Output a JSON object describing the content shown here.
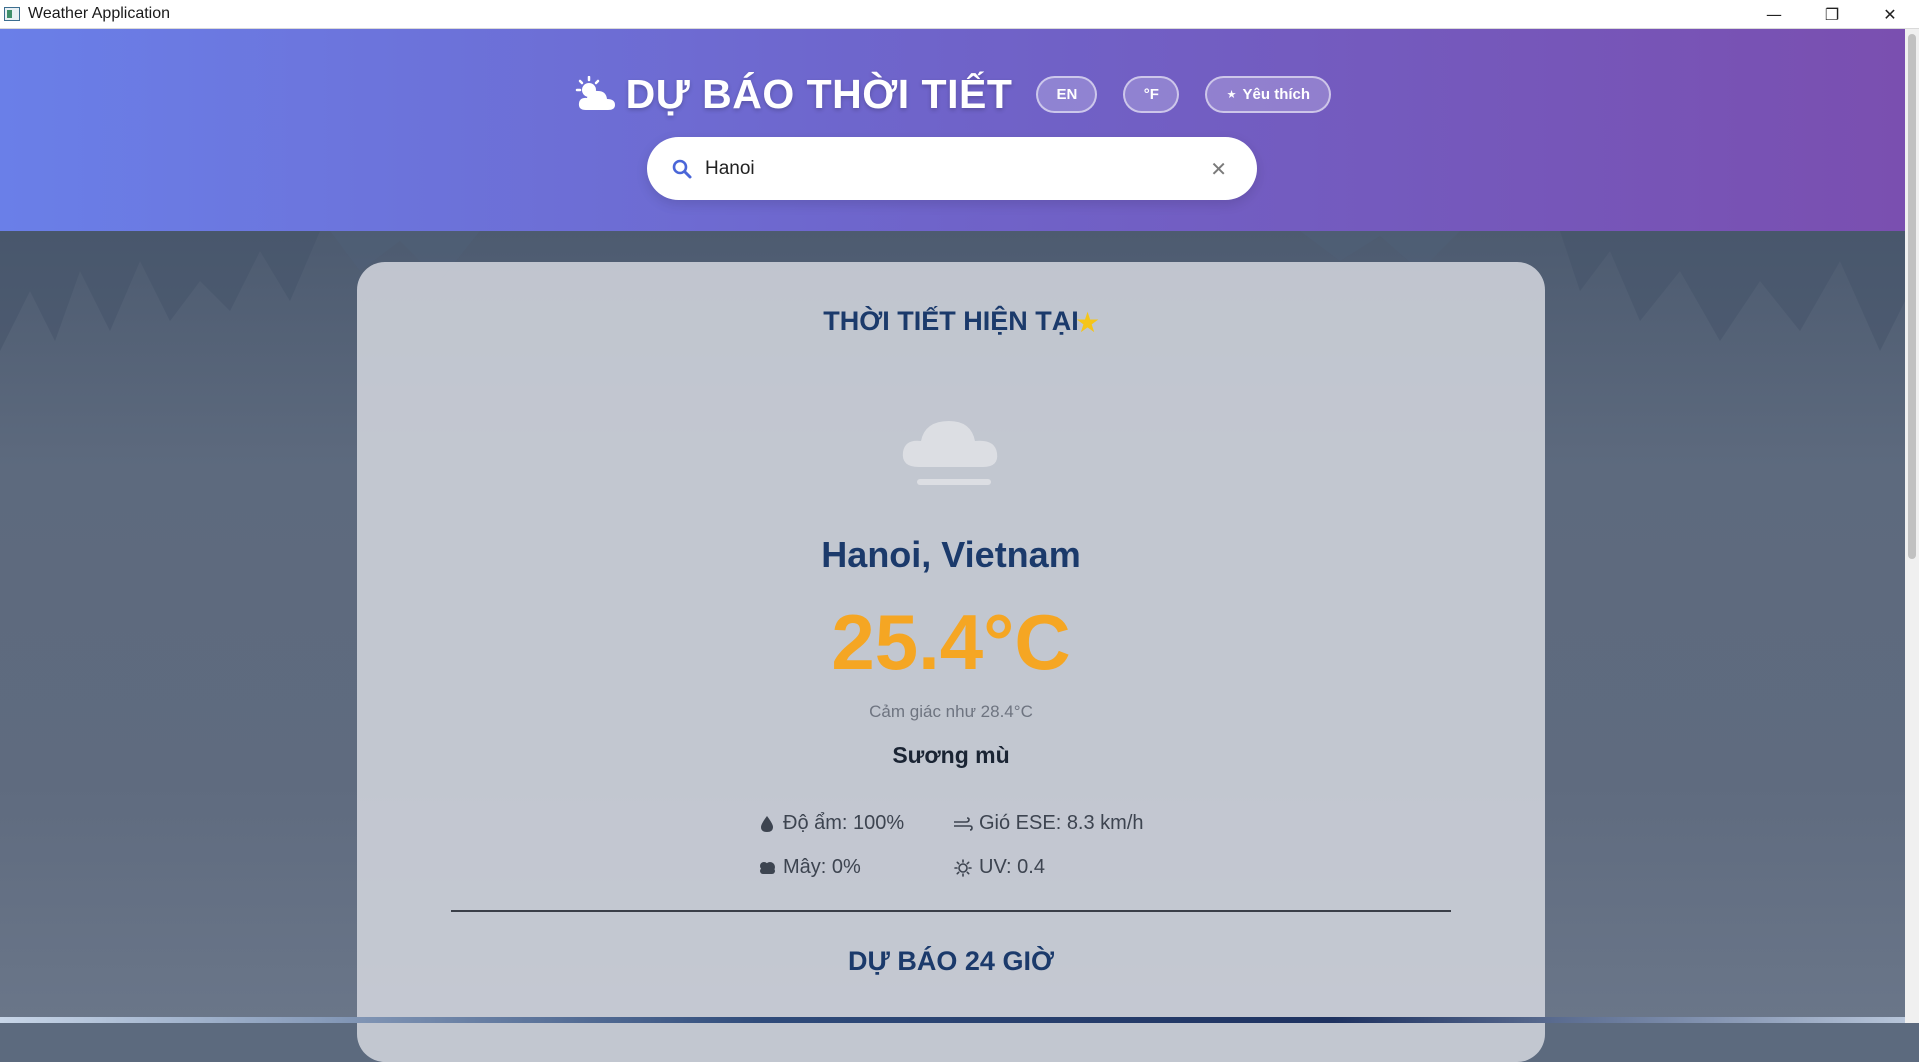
{
  "window": {
    "title": "Weather Application",
    "minimize_glyph": "—",
    "restore_glyph": "❐",
    "close_glyph": "✕"
  },
  "header": {
    "app_title": "DỰ BÁO THỜI TIẾT",
    "brand_icon": "sun-cloud-icon",
    "lang_button": "EN",
    "unit_button": "°F",
    "favorites_star": "★",
    "favorites_button": "Yêu thích"
  },
  "search": {
    "value": "Hanoi",
    "icon": "search-icon",
    "clear_glyph": "✕"
  },
  "current": {
    "section_title": "THỜI TIẾT HIỆN TẠI",
    "favorite_star": "★",
    "weather_icon": "fog-icon",
    "location": "Hanoi, Vietnam",
    "temperature": "25.4°C",
    "feels_like": "Cảm giác như 28.4°C",
    "condition": "Sương mù",
    "details": {
      "humidity": "Độ ẩm: 100%",
      "wind": "Gió ESE: 8.3 km/h",
      "clouds": "Mây: 0%",
      "uv": "UV: 0.4"
    }
  },
  "forecast": {
    "section_title": "DỰ BÁO 24 GIỜ"
  },
  "colors": {
    "header_gradient_start": "#6a7fe8",
    "header_gradient_end": "#7a4fb0",
    "title_blue": "#1b3a6b",
    "temperature_orange": "#f5a623",
    "star_yellow": "#f5c518"
  }
}
